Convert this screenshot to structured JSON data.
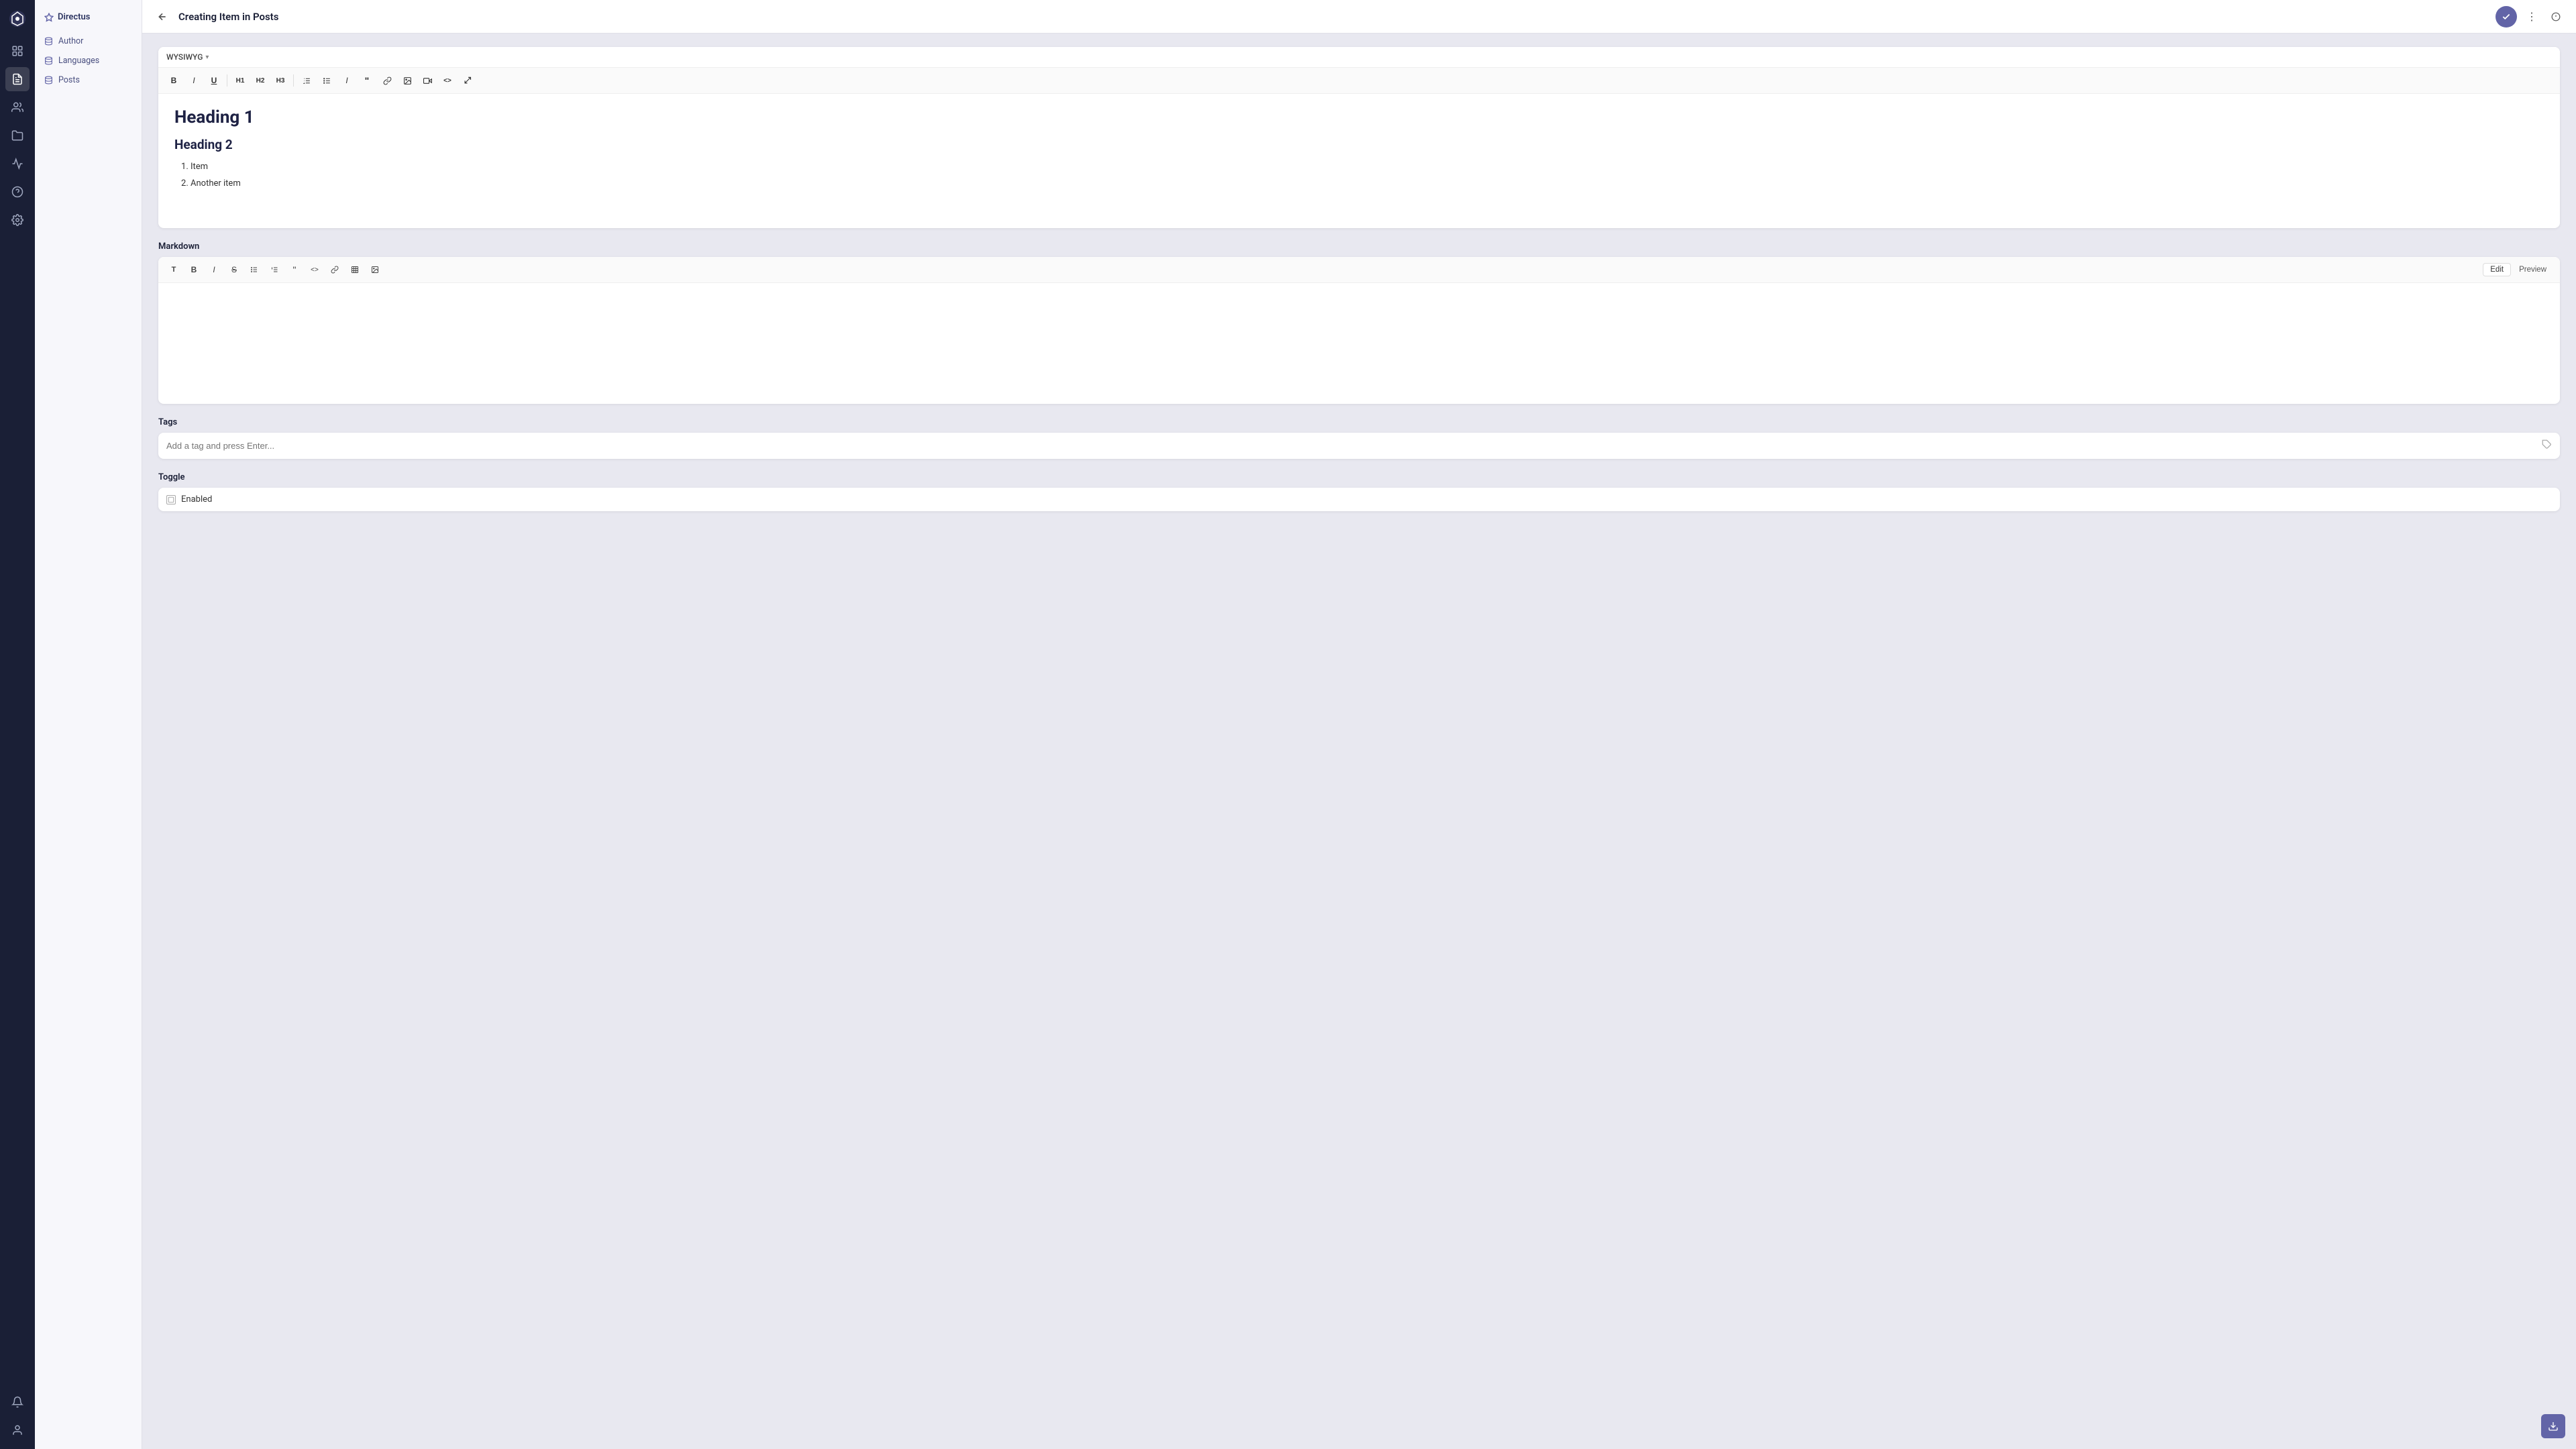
{
  "app": {
    "brand": "Directus",
    "nav_icon": "◆"
  },
  "sidebar": {
    "items": [
      {
        "id": "author",
        "label": "Author",
        "icon": "collection"
      },
      {
        "id": "languages",
        "label": "Languages",
        "icon": "collection"
      },
      {
        "id": "posts",
        "label": "Posts",
        "icon": "collection"
      }
    ]
  },
  "topbar": {
    "title": "Creating Item in Posts",
    "back_label": "←",
    "save_label": "✓",
    "more_label": "⋮",
    "info_label": "ℹ"
  },
  "wysiwyg": {
    "mode_label": "WYSIWYG",
    "heading1": "Heading 1",
    "heading2": "Heading 2",
    "list_items": [
      "Item",
      "Another item"
    ],
    "toolbar": {
      "bold": "B",
      "italic": "I",
      "underline": "U",
      "h1": "H1",
      "h2": "H2",
      "h3": "H3"
    }
  },
  "markdown": {
    "section_label": "Markdown",
    "edit_tab": "Edit",
    "preview_tab": "Preview"
  },
  "tags": {
    "section_label": "Tags",
    "placeholder": "Add a tag and press Enter..."
  },
  "toggle": {
    "section_label": "Toggle",
    "option_label": "Enabled"
  },
  "icons": {
    "check": "✓",
    "more": "⋮",
    "info": "ℹ",
    "back": "←",
    "tag": "🏷",
    "table": "⊞",
    "image": "⊡",
    "code": "<>",
    "fullscreen": "⤢",
    "link": "🔗",
    "quote": "❝",
    "bullet": "≡",
    "ordered": "≡",
    "indent": "→",
    "strikethrough": "S̶",
    "bell": "🔔",
    "user": "👤",
    "upload": "⬆"
  }
}
